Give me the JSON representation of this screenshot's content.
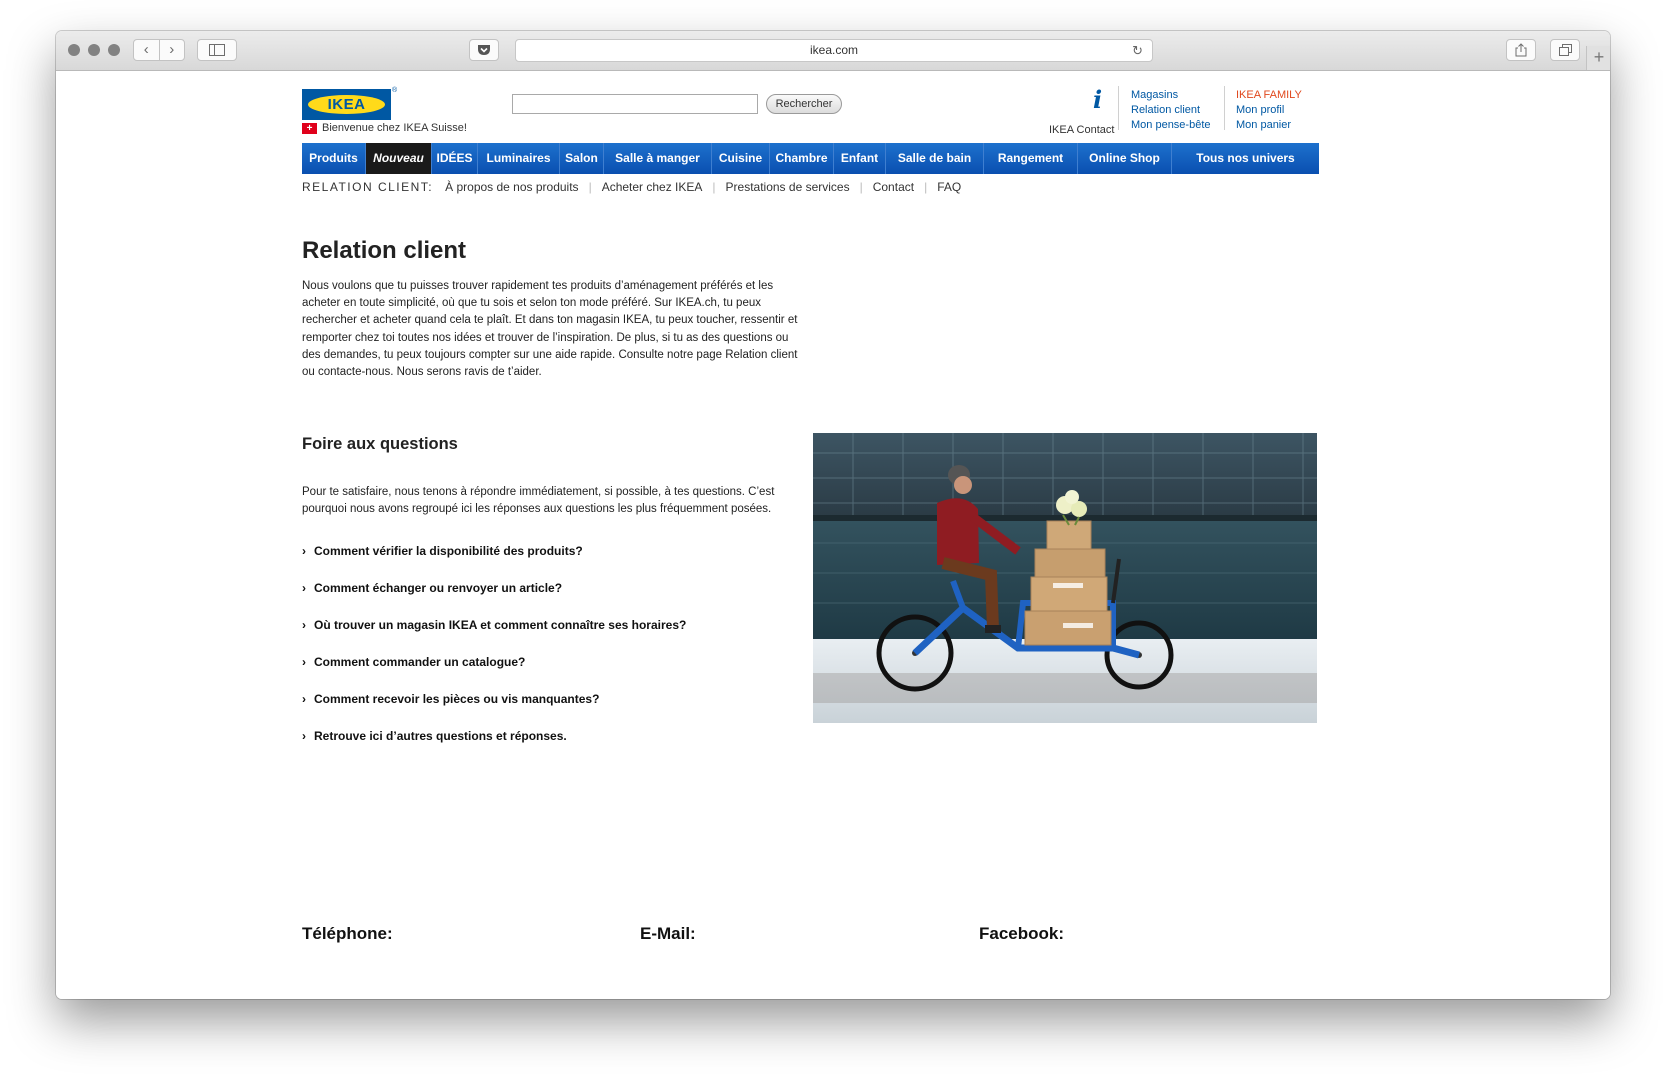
{
  "browser": {
    "url": "ikea.com",
    "nav_back": "‹",
    "nav_forward": "›",
    "reload": "↻",
    "newtab": "+"
  },
  "header": {
    "logo_text": "IKEA",
    "logo_registered": "®",
    "flag_glyph": "+",
    "welcome": "Bienvenue chez IKEA Suisse!",
    "search_placeholder": "",
    "search_button": "Rechercher",
    "info_glyph": "i",
    "info_label": "IKEA Contact",
    "links_col1": [
      "Magasins",
      "Relation client",
      "Mon pense-bête"
    ],
    "family_title": "IKEA FAMILY",
    "links_col2": [
      "Mon profil",
      "Mon panier"
    ]
  },
  "mainnav": {
    "items": [
      "Produits",
      "Nouveau",
      "IDÉES",
      "Luminaires",
      "Salon",
      "Salle à manger",
      "Cuisine",
      "Chambre",
      "Enfant",
      "Salle de bain",
      "Rangement",
      "Online Shop",
      "Tous nos univers"
    ]
  },
  "subnav": {
    "label": "RELATION CLIENT:",
    "links": [
      "À propos de nos produits",
      "Acheter chez IKEA",
      "Prestations de services",
      "Contact",
      "FAQ"
    ]
  },
  "main": {
    "title": "Relation client",
    "intro": "Nous voulons que tu puisses trouver rapidement tes produits d’aménagement préférés et les acheter en toute simplicité, où que tu sois et selon ton mode préféré. Sur IKEA.ch, tu peux rechercher et acheter quand cela te plaît. Et dans ton magasin IKEA, tu peux toucher, ressentir et remporter chez toi toutes nos idées et trouver de l’inspiration. De plus, si tu as des questions ou des demandes, tu peux toujours compter sur une aide rapide. Consulte notre page Relation client ou contacte-nous. Nous serons ravis de t’aider.",
    "faq_title": "Foire aux questions",
    "faq_text": "Pour te satisfaire, nous tenons à répondre immédiatement, si possible, à tes questions. C’est pourquoi nous avons regroupé ici les réponses aux questions les plus fréquemment posées.",
    "faq_items": [
      "Comment vérifier la disponibilité des produits?",
      "Comment échanger ou renvoyer un article?",
      "Où trouver un magasin IKEA et comment connaître ses horaires?",
      "Comment commander un catalogue?",
      "Comment recevoir les pièces ou vis manquantes?",
      "Retrouve ici d’autres questions et réponses."
    ],
    "faq_chevron": "›"
  },
  "footer": {
    "phone": "Téléphone:",
    "email": "E-Mail:",
    "facebook": "Facebook:"
  }
}
